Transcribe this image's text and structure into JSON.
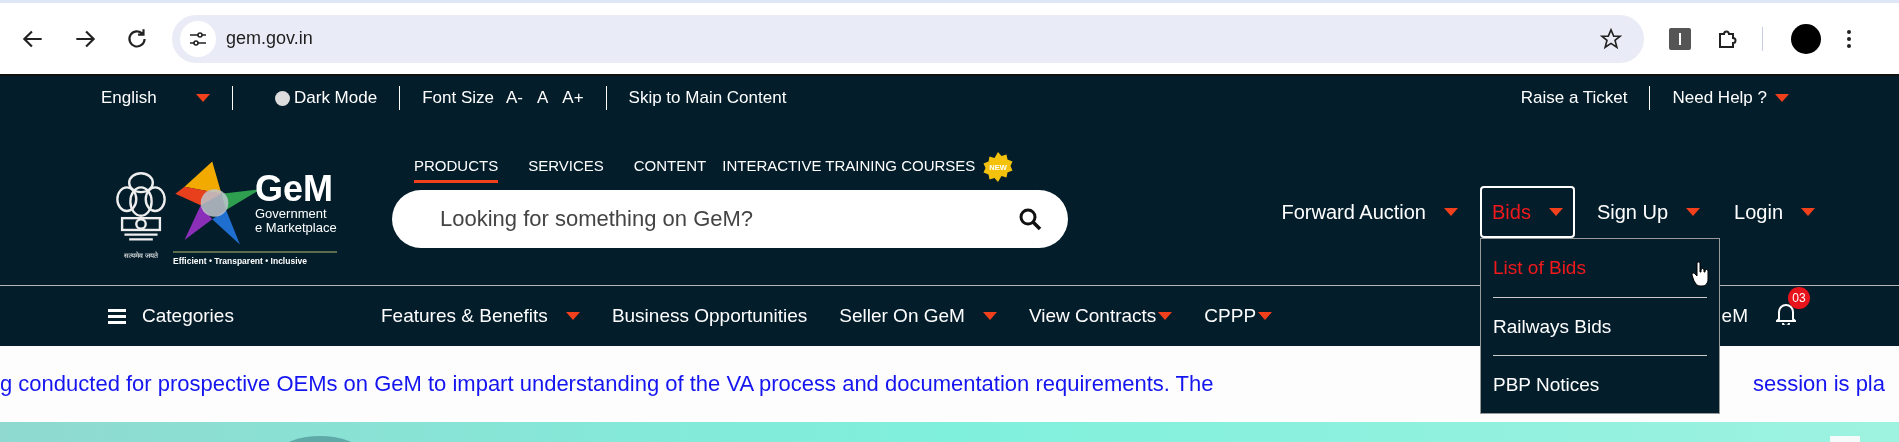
{
  "browser": {
    "url": "gem.gov.in"
  },
  "top_bar": {
    "language": "English",
    "dark_mode": {
      "label": "Dark Mode",
      "on": false
    },
    "font_size": {
      "label": "Font Size",
      "options": [
        "A-",
        "A",
        "A+"
      ]
    },
    "skip_link": "Skip to Main Content",
    "right_links": [
      {
        "label": "Raise a Ticket",
        "dropdown": false
      },
      {
        "label": "Need Help ?",
        "dropdown": true
      }
    ]
  },
  "header": {
    "logo": {
      "motto": "सत्यमेव जयते",
      "name": "GeM",
      "line1": "Government",
      "line2": "e Marketplace",
      "tagline": "Efficient • Transparent • Inclusive"
    },
    "tabs": [
      {
        "label": "PRODUCTS",
        "selected": true
      },
      {
        "label": "SERVICES",
        "selected": false
      },
      {
        "label": "CONTENT",
        "selected": false
      },
      {
        "label": "INTERACTIVE TRAINING COURSES",
        "selected": false,
        "badge": "NEW"
      }
    ],
    "search": {
      "placeholder": "Looking for something on GeM?"
    },
    "nav": [
      {
        "label": "Forward Auction",
        "selected": false
      },
      {
        "label": "Bids",
        "selected": true
      },
      {
        "label": "Sign Up",
        "selected": false
      },
      {
        "label": "Login",
        "selected": false
      }
    ],
    "dropdown": [
      {
        "label": "List of Bids",
        "selected": true
      },
      {
        "label": "Railways Bids",
        "selected": false
      },
      {
        "label": "PBP Notices",
        "selected": false
      }
    ]
  },
  "nav_bar": {
    "categories": "Categories",
    "items": [
      {
        "label": "Features & Benefits",
        "dropdown": true
      },
      {
        "label": "Business Opportunities",
        "dropdown": false
      },
      {
        "label": "Seller On GeM",
        "dropdown": true
      },
      {
        "label": "View Contracts",
        "dropdown": true
      },
      {
        "label": "CPPP",
        "dropdown": true
      }
    ],
    "partial_item": "eM",
    "notifications": "03"
  },
  "ticker": {
    "segments": [
      "g conducted for prospective OEMs on GeM to impart understanding of the VA process and documentation requirements. The",
      "session is pla"
    ]
  }
}
